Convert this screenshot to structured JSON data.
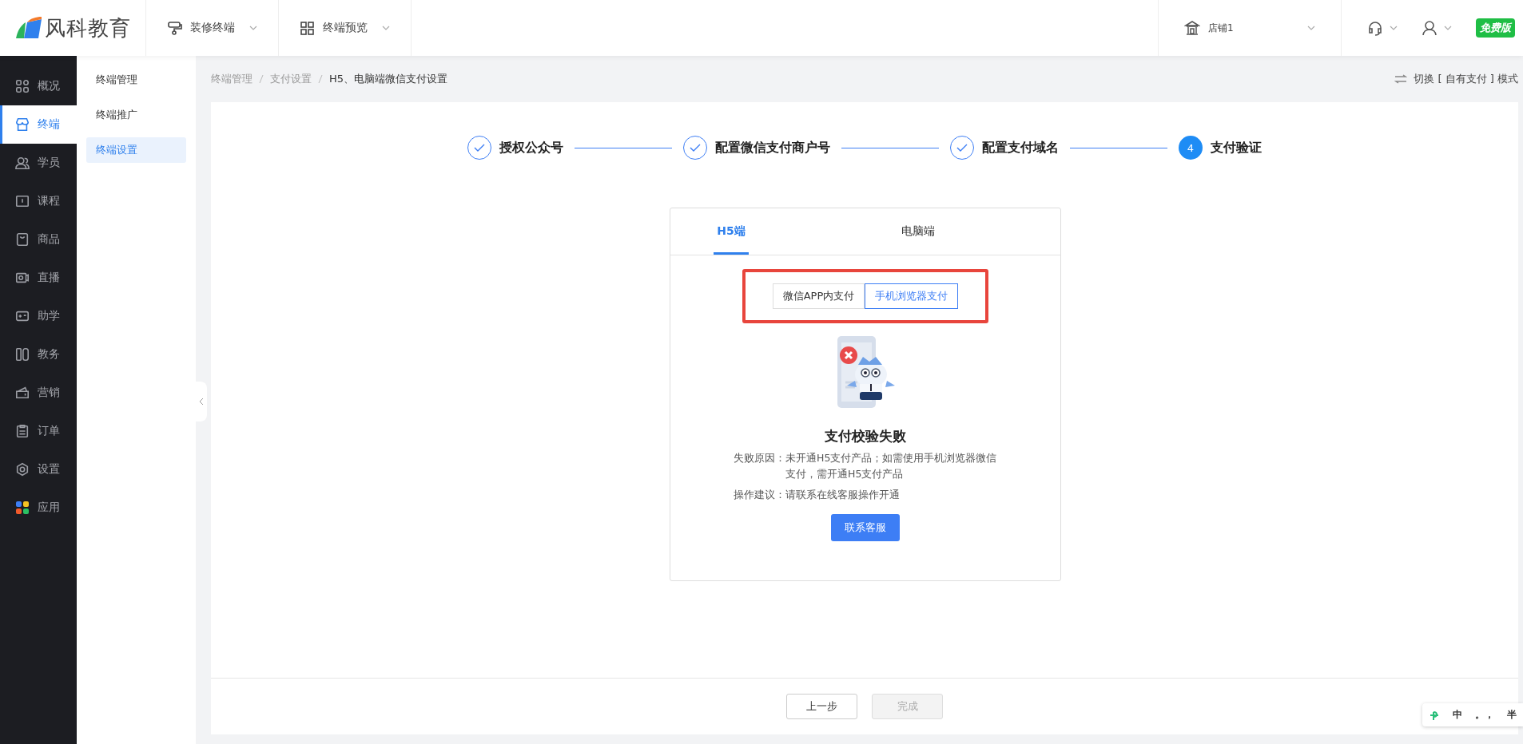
{
  "header": {
    "logo": "风科教育",
    "nav": [
      {
        "label": "装修终端",
        "kind": "roller"
      },
      {
        "label": "终端预览",
        "kind": "grid"
      }
    ],
    "store": "店铺1",
    "badge": "免费版"
  },
  "sidebar": {
    "items": [
      {
        "label": "概况",
        "selected": false
      },
      {
        "label": "终端",
        "selected": true
      },
      {
        "label": "学员",
        "selected": false
      },
      {
        "label": "课程",
        "selected": false
      },
      {
        "label": "商品",
        "selected": false
      },
      {
        "label": "直播",
        "selected": false
      },
      {
        "label": "助学",
        "selected": false
      },
      {
        "label": "教务",
        "selected": false
      },
      {
        "label": "营销",
        "selected": false
      },
      {
        "label": "订单",
        "selected": false
      },
      {
        "label": "设置",
        "selected": false
      },
      {
        "label": "应用",
        "selected": false
      }
    ]
  },
  "subnav": {
    "items": [
      {
        "label": "终端管理",
        "selected": false
      },
      {
        "label": "终端推广",
        "selected": false
      },
      {
        "label": "终端设置",
        "selected": true
      }
    ]
  },
  "breadcrumb": [
    "终端管理",
    "支付设置",
    "H5、电脑端微信支付设置"
  ],
  "mode_switch": "切换 [ 自有支付 ] 模式",
  "steps": [
    {
      "label": "授权公众号",
      "done": true
    },
    {
      "label": "配置微信支付商户号",
      "done": true
    },
    {
      "label": "配置支付域名",
      "done": true
    },
    {
      "label": "支付验证",
      "done": false,
      "number": "4"
    }
  ],
  "tabs": [
    {
      "label": "H5端",
      "selected": true
    },
    {
      "label": "电脑端",
      "selected": false
    }
  ],
  "segments": {
    "highlighted": true,
    "items": [
      {
        "label": "微信APP内支付",
        "selected": false
      },
      {
        "label": "手机浏览器支付",
        "selected": true
      }
    ]
  },
  "result": {
    "title": "支付校验失败",
    "reason_label": "失败原因：",
    "reason": "未开通H5支付产品；如需使用手机浏览器微信支付，需开通H5支付产品",
    "advice_label": "操作建议：",
    "advice": "请联系在线客服操作开通",
    "button": "联系客服"
  },
  "footer": {
    "buttons": [
      {
        "label": "上一步",
        "disabled": false
      },
      {
        "label": "完成",
        "disabled": true
      }
    ]
  },
  "ime_toolbar": [
    "中",
    "。，",
    "半"
  ]
}
